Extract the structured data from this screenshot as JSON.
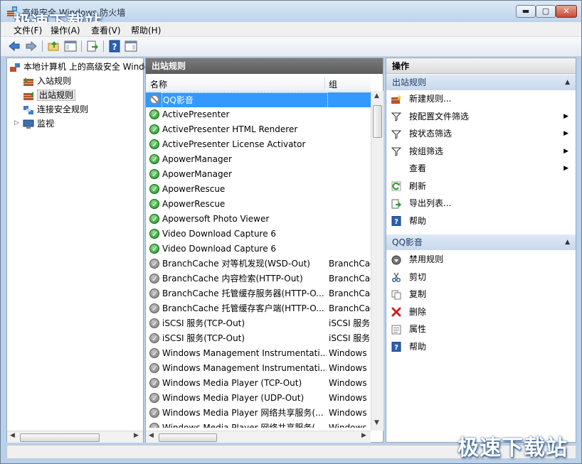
{
  "window": {
    "title": "高级安全 Windows 防火墙",
    "watermark": "极速下载站"
  },
  "menu": [
    "文件(F)",
    "操作(A)",
    "查看(V)",
    "帮助(H)"
  ],
  "toolbar": [
    "back-icon",
    "forward-icon",
    "up-folder-icon",
    "show-tree-icon",
    "export-icon",
    "help-icon",
    "show-action-pane-icon"
  ],
  "tree": {
    "root": "本地计算机 上的高级安全 Windows 防火墙",
    "items": [
      "入站规则",
      "出站规则",
      "连接安全规则",
      "监视"
    ]
  },
  "middle": {
    "header": "出站规则",
    "col_name": "名称",
    "col_group": "组",
    "rows": [
      {
        "name": "QQ影音",
        "group": "",
        "state": "block"
      },
      {
        "name": "ActivePresenter",
        "group": "",
        "state": "enabled"
      },
      {
        "name": "ActivePresenter HTML Renderer",
        "group": "",
        "state": "enabled"
      },
      {
        "name": "ActivePresenter License Activator",
        "group": "",
        "state": "enabled"
      },
      {
        "name": "ApowerManager",
        "group": "",
        "state": "enabled"
      },
      {
        "name": "ApowerManager",
        "group": "",
        "state": "enabled"
      },
      {
        "name": "ApowerRescue",
        "group": "",
        "state": "enabled"
      },
      {
        "name": "ApowerRescue",
        "group": "",
        "state": "enabled"
      },
      {
        "name": "Apowersoft Photo Viewer",
        "group": "",
        "state": "enabled"
      },
      {
        "name": "Video Download Capture 6",
        "group": "",
        "state": "enabled"
      },
      {
        "name": "Video Download Capture 6",
        "group": "",
        "state": "enabled"
      },
      {
        "name": "BranchCache 对等机发现(WSD-Out)",
        "group": "BranchCac",
        "state": "disabled"
      },
      {
        "name": "BranchCache 内容检索(HTTP-Out)",
        "group": "BranchCac",
        "state": "disabled"
      },
      {
        "name": "BranchCache 托管缓存服务器(HTTP-O...",
        "group": "BranchCac",
        "state": "disabled"
      },
      {
        "name": "BranchCache 托管缓存客户端(HTTP-O...",
        "group": "BranchCac",
        "state": "disabled"
      },
      {
        "name": "iSCSI 服务(TCP-Out)",
        "group": "iSCSI 服务",
        "state": "disabled"
      },
      {
        "name": "iSCSI 服务(TCP-Out)",
        "group": "iSCSI 服务",
        "state": "disabled"
      },
      {
        "name": "Windows Management Instrumentati...",
        "group": "Windows",
        "state": "disabled"
      },
      {
        "name": "Windows Management Instrumentati...",
        "group": "Windows",
        "state": "disabled"
      },
      {
        "name": "Windows Media Player (TCP-Out)",
        "group": "Windows",
        "state": "disabled"
      },
      {
        "name": "Windows Media Player (UDP-Out)",
        "group": "Windows",
        "state": "disabled"
      },
      {
        "name": "Windows Media Player 网络共享服务(...",
        "group": "Windows",
        "state": "disabled"
      },
      {
        "name": "Windows Media Player 网络共享服务(...",
        "group": "Windows",
        "state": "disabled"
      }
    ]
  },
  "actions": {
    "header": "操作",
    "section1": {
      "title": "出站规则",
      "items": [
        {
          "label": "新建规则...",
          "icon": "new-rule-icon",
          "sub": false
        },
        {
          "label": "按配置文件筛选",
          "icon": "filter-icon",
          "sub": true
        },
        {
          "label": "按状态筛选",
          "icon": "filter-icon",
          "sub": true
        },
        {
          "label": "按组筛选",
          "icon": "filter-icon",
          "sub": true
        },
        {
          "label": "查看",
          "icon": "",
          "sub": true
        },
        {
          "label": "刷新",
          "icon": "refresh-icon",
          "sub": false
        },
        {
          "label": "导出列表...",
          "icon": "export-list-icon",
          "sub": false
        },
        {
          "label": "帮助",
          "icon": "help-icon",
          "sub": false
        }
      ]
    },
    "section2": {
      "title": "QQ影音",
      "items": [
        {
          "label": "禁用规则",
          "icon": "disable-rule-icon"
        },
        {
          "label": "剪切",
          "icon": "cut-icon"
        },
        {
          "label": "复制",
          "icon": "copy-icon"
        },
        {
          "label": "删除",
          "icon": "delete-icon"
        },
        {
          "label": "属性",
          "icon": "properties-icon"
        },
        {
          "label": "帮助",
          "icon": "help-icon"
        }
      ]
    }
  },
  "colors": {
    "selection": "#3399ff",
    "enabled": "#1d8d1d",
    "delete": "#d42020",
    "section_head": "#c9d9ec"
  }
}
